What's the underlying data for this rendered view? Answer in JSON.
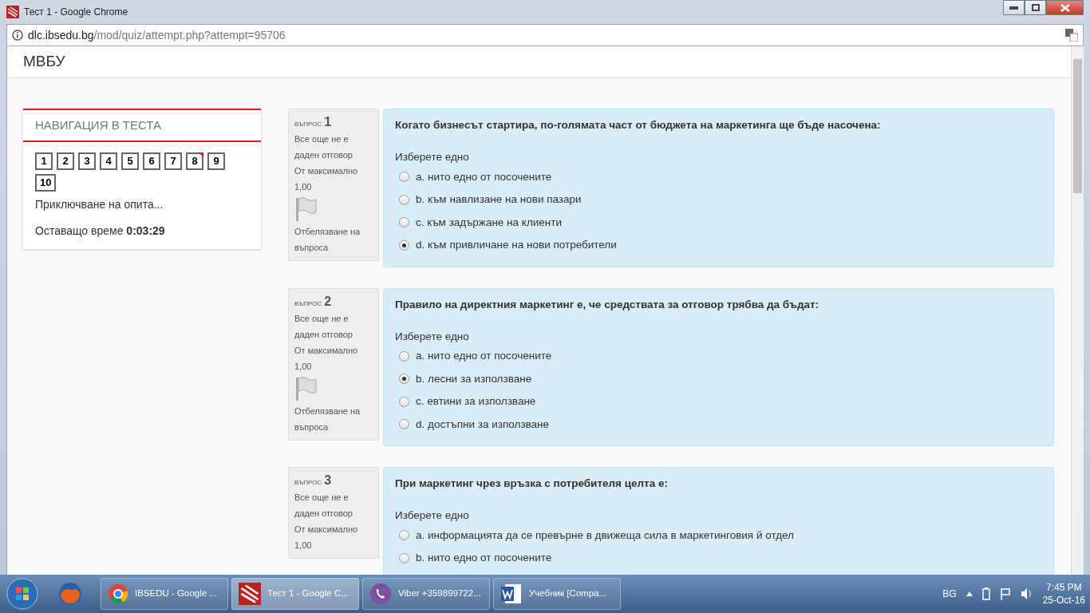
{
  "window": {
    "title": "Тест 1 - Google Chrome"
  },
  "address_bar": {
    "host": "dlc.ibsedu.bg",
    "path": "/mod/quiz/attempt.php?attempt=95706"
  },
  "site_title": "МВБУ",
  "quiz_nav": {
    "title": "НАВИГАЦИЯ В ТЕСТА",
    "buttons": [
      {
        "label": "1",
        "flagged": false
      },
      {
        "label": "2",
        "flagged": false
      },
      {
        "label": "3",
        "flagged": false
      },
      {
        "label": "4",
        "flagged": false
      },
      {
        "label": "5",
        "flagged": false
      },
      {
        "label": "6",
        "flagged": false
      },
      {
        "label": "7",
        "flagged": false
      },
      {
        "label": "8",
        "flagged": true
      },
      {
        "label": "9",
        "flagged": false
      },
      {
        "label": "10",
        "flagged": false
      }
    ],
    "finish_link": "Приключване на опита...",
    "time_label": "Оставащо време",
    "time_value": "0:03:29"
  },
  "questions": [
    {
      "label": "въпрос",
      "number": "1",
      "status": "Все още не е даден отговор",
      "max_label": "От максимално",
      "max_value": "1,00",
      "flag_label": "Отбелязване на въпроса",
      "text": "Когато бизнесът стартира, по-голямата част от бюджета на маркетинга ще бъде насочена:",
      "prompt": "Изберете едно",
      "options": [
        {
          "label": "a. нито едно от посочените",
          "selected": false
        },
        {
          "label": "b. към навлизане на нови пазари",
          "selected": false
        },
        {
          "label": "c. към задържане на клиенти",
          "selected": false
        },
        {
          "label": "d. към привличане на нови потребители",
          "selected": true
        }
      ]
    },
    {
      "label": "въпрос",
      "number": "2",
      "status": "Все още не е даден отговор",
      "max_label": "От максимално",
      "max_value": "1,00",
      "flag_label": "Отбелязване на въпроса",
      "text": "Правило на директния маркетинг е, че средствата за отговор трябва да бъдат:",
      "prompt": "Изберете едно",
      "options": [
        {
          "label": "a. нито едно от посочените",
          "selected": false
        },
        {
          "label": "b. лесни за използване",
          "selected": true
        },
        {
          "label": "c. евтини за използване",
          "selected": false
        },
        {
          "label": "d. достъпни за използване",
          "selected": false
        }
      ]
    },
    {
      "label": "въпрос",
      "number": "3",
      "status": "Все още не е даден отговор",
      "max_label": "От максимално",
      "max_value": "1,00",
      "text": "При маркетинг чрез връзка с потребителя целта е:",
      "prompt": "Изберете едно",
      "options": [
        {
          "label": "a. информацията да се превърне в движеща сила в маркетинговия й отдел",
          "selected": false
        },
        {
          "label": "b. нито едно от посочените",
          "selected": false
        }
      ]
    }
  ],
  "taskbar": {
    "items": [
      {
        "kind": "chrome",
        "label": "IBSEDU - Google ...",
        "active": false
      },
      {
        "kind": "quiz",
        "label": "Тест 1 - Google C...",
        "active": true
      },
      {
        "kind": "viber",
        "label": "Viber +359899722...",
        "active": false
      },
      {
        "kind": "word",
        "label": "Учебник [Compa...",
        "active": false
      }
    ],
    "language": "BG",
    "time": "7:45 PM",
    "date": "25-Oct-16"
  }
}
